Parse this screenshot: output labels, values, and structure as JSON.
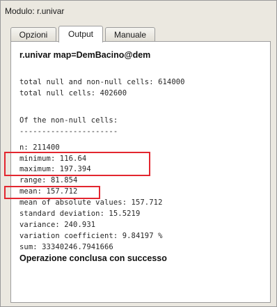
{
  "window": {
    "title": "Modulo: r.univar"
  },
  "tabs": [
    {
      "label": "Opzioni",
      "active": false
    },
    {
      "label": "Output",
      "active": true
    },
    {
      "label": "Manuale",
      "active": false
    }
  ],
  "output": {
    "command": "r.univar map=DemBacino@dem",
    "lines": [
      "total null and non-null cells: 614000",
      "total null cells: 402600",
      "Of the non-null cells:",
      "----------------------",
      "n: 211400",
      "minimum: 116.64",
      "maximum: 197.394",
      "range: 81.854",
      "mean: 157.712",
      "mean of absolute values: 157.712",
      "standard deviation: 15.5219",
      "variance: 240.931",
      "variation coefficient: 9.84197 %",
      "sum: 33340246.7941666"
    ],
    "status": "Operazione conclusa con successo"
  },
  "colors": {
    "highlight": "#e3262f",
    "panel_bg": "#ffffff",
    "window_bg": "#ebe8e0"
  }
}
